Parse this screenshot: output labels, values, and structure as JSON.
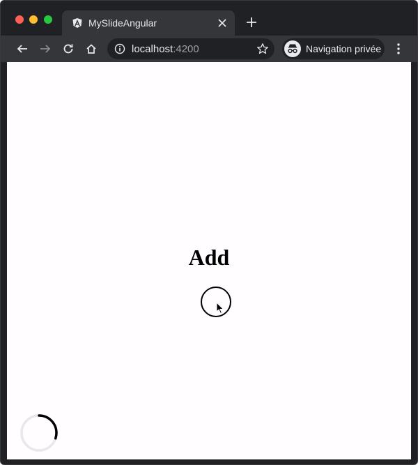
{
  "browser": {
    "tab": {
      "title": "MySlideAngular",
      "favicon": "angular-logo-icon"
    },
    "toolbar": {
      "back_icon": "back-arrow-icon",
      "forward_icon": "forward-arrow-icon",
      "reload_icon": "reload-icon",
      "home_icon": "home-icon"
    },
    "address": {
      "host": "localhost",
      "port": ":4200"
    },
    "profile": {
      "label": "Navigation privée",
      "icon": "incognito-icon"
    }
  },
  "page": {
    "heading": "Add",
    "action_icon": "circle-button"
  },
  "colors": {
    "frame": "#202124",
    "toolbar": "#35363a",
    "content_bg": "#fffdff",
    "close_dot": "#fe5f57",
    "min_dot": "#febc2e",
    "max_dot": "#28c840"
  },
  "loading_indicator": {
    "progress": 0.3
  }
}
